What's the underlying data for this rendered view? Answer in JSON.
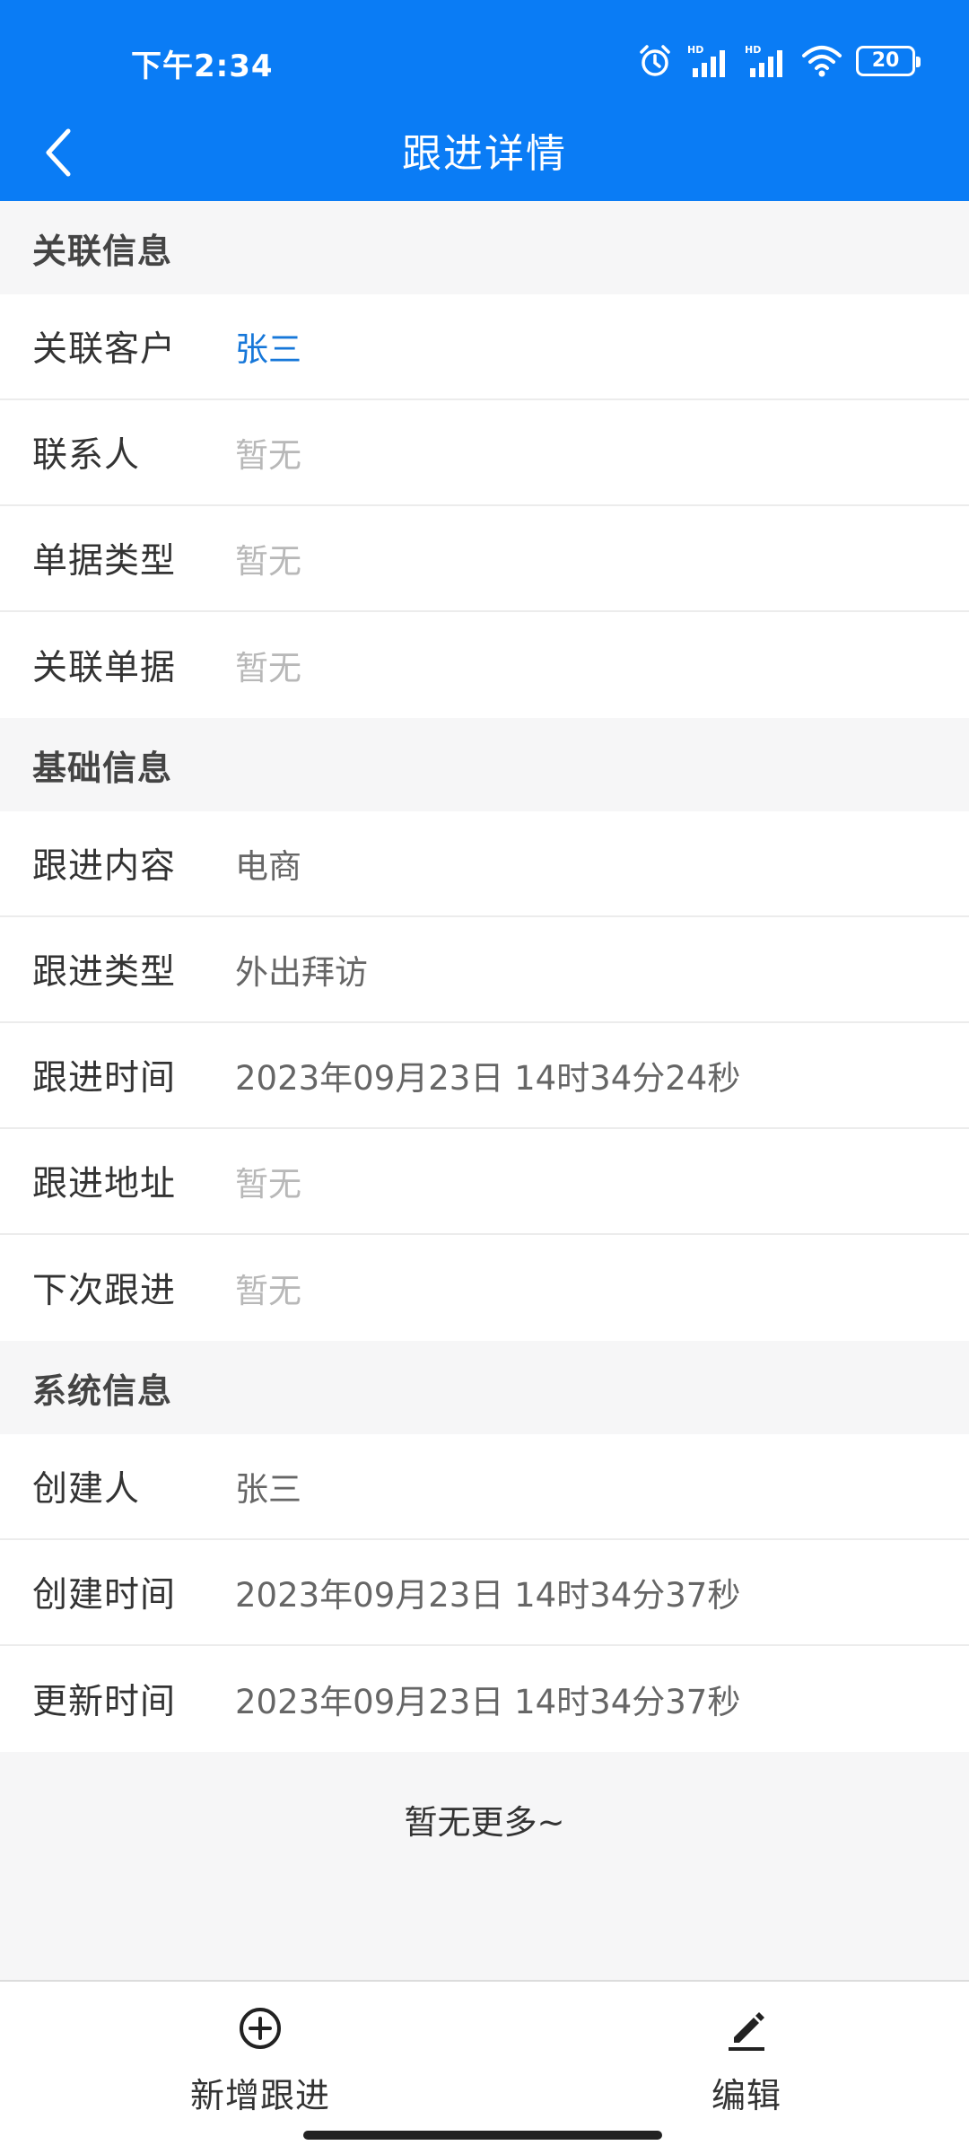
{
  "status_bar": {
    "time": "下午2:34",
    "battery": "20",
    "icons": [
      "alarm-icon",
      "hd-signal-icon",
      "hd-signal-icon",
      "wifi-icon",
      "battery-icon"
    ]
  },
  "nav": {
    "title": "跟进详情",
    "back_icon": "chevron-left-icon"
  },
  "sections": {
    "related": {
      "title": "关联信息",
      "rows": [
        {
          "label": "关联客户",
          "value": "张三"
        },
        {
          "label": "联系人",
          "value": "暂无"
        },
        {
          "label": "单据类型",
          "value": "暂无"
        },
        {
          "label": "关联单据",
          "value": "暂无"
        }
      ]
    },
    "basic": {
      "title": "基础信息",
      "rows": [
        {
          "label": "跟进内容",
          "value": "电商"
        },
        {
          "label": "跟进类型",
          "value": "外出拜访"
        },
        {
          "label": "跟进时间",
          "value": "2023年09月23日 14时34分24秒"
        },
        {
          "label": "跟进地址",
          "value": "暂无"
        },
        {
          "label": "下次跟进",
          "value": "暂无"
        }
      ]
    },
    "system": {
      "title": "系统信息",
      "rows": [
        {
          "label": "创建人",
          "value": "张三"
        },
        {
          "label": "创建时间",
          "value": "2023年09月23日 14时34分37秒"
        },
        {
          "label": "更新时间",
          "value": "2023年09月23日 14时34分37秒"
        }
      ]
    }
  },
  "footer_note": "暂无更多~",
  "bottom_bar": {
    "add_label": "新增跟进",
    "add_icon": "plus-circle-icon",
    "edit_label": "编辑",
    "edit_icon": "pencil-icon"
  },
  "colors": {
    "header": "#0a7cf5",
    "link": "#1677d9",
    "empty": "#b8b8b8"
  }
}
